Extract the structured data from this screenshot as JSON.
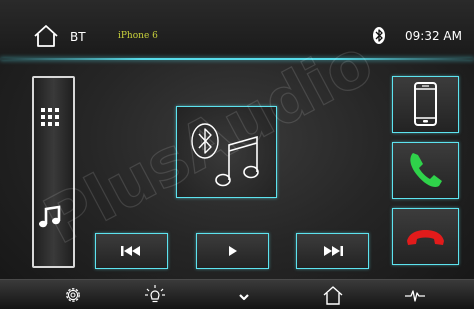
{
  "header": {
    "source_label": "BT",
    "device_name": "iPhone 6",
    "clock": "09:32 AM"
  },
  "watermark_text": "PlusAudio",
  "colors": {
    "accent": "#58dcea",
    "device_name": "#c9d23b",
    "answer_green": "#2fd24a",
    "hangup_red": "#e21b1b"
  },
  "icons": {
    "home": "home-icon",
    "bluetooth": "bluetooth-icon",
    "apps": "apps-grid-icon",
    "music": "music-note-icon",
    "previous": "skip-previous-icon",
    "play": "play-icon",
    "next": "skip-next-icon",
    "phone_device": "smartphone-icon",
    "answer": "phone-answer-icon",
    "hangup": "phone-hangup-icon",
    "settings": "gear-icon",
    "brightness": "brightness-icon",
    "collapse": "chevron-down-icon",
    "home_bottom": "home-icon",
    "equalizer": "waveform-icon"
  }
}
